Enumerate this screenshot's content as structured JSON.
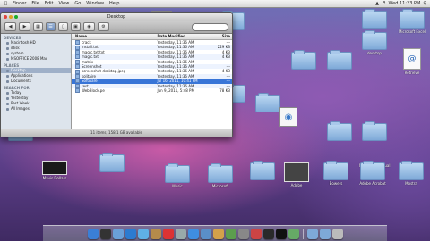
{
  "menubar": {
    "apple": "",
    "items": [
      "Finder",
      "File",
      "Edit",
      "View",
      "Go",
      "Window",
      "Help"
    ],
    "clock": "Wed 11:23 PM"
  },
  "finder": {
    "title": "Desktop",
    "sidebar": {
      "devices_header": "DEVICES",
      "devices": [
        "Macintosh HD",
        "iDisk",
        "system",
        "MSOFFICE 2008 Mac"
      ],
      "places_header": "PLACES",
      "places": [
        "Desktop",
        "Applications",
        "Documents"
      ],
      "search_header": "SEARCH FOR",
      "searches": [
        "Today",
        "Yesterday",
        "Past Week",
        "All Images"
      ]
    },
    "columns": {
      "name": "Name",
      "date": "Date Modified",
      "size": "Size"
    },
    "rows": [
      {
        "name": "crack",
        "date": "Yesterday, 11:36 AM",
        "size": "---"
      },
      {
        "name": "install.txt",
        "date": "Yesterday, 11:36 AM",
        "size": "229 KB"
      },
      {
        "name": "magic.txt.txt",
        "date": "Yesterday, 11:36 AM",
        "size": "4 KB"
      },
      {
        "name": "magic.txt",
        "date": "Yesterday, 11:36 AM",
        "size": "4 KB"
      },
      {
        "name": "matrix",
        "date": "Yesterday, 11:36 AM",
        "size": "---"
      },
      {
        "name": "Screenshot",
        "date": "Yesterday, 11:36 AM",
        "size": "---"
      },
      {
        "name": "screenshot-desktop.jpeg",
        "date": "Yesterday, 11:36 AM",
        "size": "4 KB"
      },
      {
        "name": "solitaire",
        "date": "Yesterday, 11:36 AM",
        "size": "---"
      },
      {
        "name": "Software",
        "date": "Jul 16, 2011, 10:41 PM",
        "size": "---"
      },
      {
        "name": "test",
        "date": "Yesterday, 11:36 AM",
        "size": "---"
      },
      {
        "name": "WebBlock.pe",
        "date": "Jun 9, 2011, 5:48 PM",
        "size": "78 KB"
      }
    ],
    "selected_row": 8,
    "status": "11 items, 158.1 GB available",
    "search_placeholder": ""
  },
  "desktop_icons": [
    {
      "label": "",
      "kind": "folder"
    },
    {
      "label": "Microsoft Excel",
      "kind": "folder"
    },
    {
      "label": "desktop",
      "kind": "folder"
    },
    {
      "label": "",
      "kind": "folder"
    },
    {
      "label": "",
      "kind": "folder"
    },
    {
      "label": "",
      "kind": "folder"
    },
    {
      "label": "Retrieve",
      "kind": "doc"
    },
    {
      "label": "",
      "kind": "folder"
    },
    {
      "label": "",
      "kind": "folder"
    },
    {
      "label": "",
      "kind": "folder"
    },
    {
      "label": "",
      "kind": "folder"
    },
    {
      "label": "Folder",
      "kind": "folder"
    },
    {
      "label": "Microsoft manual",
      "kind": "folder"
    },
    {
      "label": "",
      "kind": "folder"
    },
    {
      "label": "Mavis Dollars",
      "kind": "image"
    },
    {
      "label": "",
      "kind": "folder"
    },
    {
      "label": "Music",
      "kind": "folder"
    },
    {
      "label": "Microsoft",
      "kind": "folder"
    },
    {
      "label": "",
      "kind": "folder"
    },
    {
      "label": "Adobe",
      "kind": "folder"
    },
    {
      "label": "Bowers",
      "kind": "folder"
    },
    {
      "label": "Adobe Acrobat",
      "kind": "folder"
    },
    {
      "label": "Mostra",
      "kind": "folder"
    }
  ],
  "dock": [
    {
      "name": "finder",
      "color": "#3b7fd6"
    },
    {
      "name": "dashboard",
      "color": "#333"
    },
    {
      "name": "mail",
      "color": "#6aa0d8"
    },
    {
      "name": "safari",
      "color": "#2c7bd0"
    },
    {
      "name": "ichat",
      "color": "#5fb0e6"
    },
    {
      "name": "address-book",
      "color": "#b58b4b"
    },
    {
      "name": "ical",
      "color": "#d33"
    },
    {
      "name": "preview",
      "color": "#9aa"
    },
    {
      "name": "itunes",
      "color": "#3f8ee0"
    },
    {
      "name": "iphoto",
      "color": "#5a8fc8"
    },
    {
      "name": "garageband",
      "color": "#d4a14a"
    },
    {
      "name": "time-machine",
      "color": "#5c9e4e"
    },
    {
      "name": "system-prefs",
      "color": "#888"
    },
    {
      "name": "app-1",
      "color": "#c44"
    },
    {
      "name": "app-2",
      "color": "#2a2a2a"
    },
    {
      "name": "terminal",
      "color": "#111"
    },
    {
      "name": "app-3",
      "color": "#6a6"
    },
    {
      "name": "folder-stack-1",
      "color": "#7ea9d8"
    },
    {
      "name": "folder-stack-2",
      "color": "#7ea9d8"
    },
    {
      "name": "trash",
      "color": "#bbb"
    }
  ]
}
